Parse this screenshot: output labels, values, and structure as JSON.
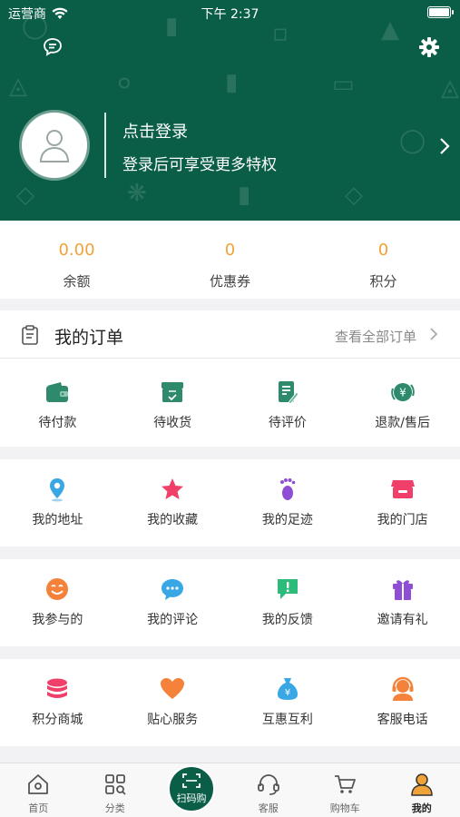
{
  "status_bar": {
    "carrier": "运营商",
    "time": "下午 2:37"
  },
  "profile": {
    "login_title": "点击登录",
    "login_subtitle": "登录后可享受更多特权"
  },
  "stats": [
    {
      "value": "0.00",
      "label": "余额"
    },
    {
      "value": "0",
      "label": "优惠券"
    },
    {
      "value": "0",
      "label": "积分"
    }
  ],
  "orders": {
    "title": "我的订单",
    "view_all": "查看全部订单",
    "items": [
      {
        "label": "待付款",
        "icon": "wallet-icon"
      },
      {
        "label": "待收货",
        "icon": "box-icon"
      },
      {
        "label": "待评价",
        "icon": "review-icon"
      },
      {
        "label": "退款/售后",
        "icon": "refund-icon"
      }
    ]
  },
  "panel1": [
    {
      "label": "我的地址",
      "icon": "location-icon"
    },
    {
      "label": "我的收藏",
      "icon": "star-icon"
    },
    {
      "label": "我的足迹",
      "icon": "footprint-icon"
    },
    {
      "label": "我的门店",
      "icon": "store-icon"
    }
  ],
  "panel2": [
    {
      "label": "我参与的",
      "icon": "smile-icon"
    },
    {
      "label": "我的评论",
      "icon": "comment-icon"
    },
    {
      "label": "我的反馈",
      "icon": "feedback-icon"
    },
    {
      "label": "邀请有礼",
      "icon": "gift-icon"
    }
  ],
  "panel3": [
    {
      "label": "积分商城",
      "icon": "coins-icon"
    },
    {
      "label": "贴心服务",
      "icon": "heart-icon"
    },
    {
      "label": "互惠互利",
      "icon": "money-bag-icon"
    },
    {
      "label": "客服电话",
      "icon": "headset-agent-icon"
    }
  ],
  "tabbar": [
    {
      "label": "首页",
      "icon": "home-icon"
    },
    {
      "label": "分类",
      "icon": "category-icon"
    },
    {
      "label": "扫码购",
      "icon": "scan-icon"
    },
    {
      "label": "客服",
      "icon": "headset-icon"
    },
    {
      "label": "购物车",
      "icon": "cart-icon"
    },
    {
      "label": "我的",
      "icon": "user-icon"
    }
  ],
  "colors": {
    "brand": "#0a5e48",
    "stat_value": "#f0a23a"
  }
}
